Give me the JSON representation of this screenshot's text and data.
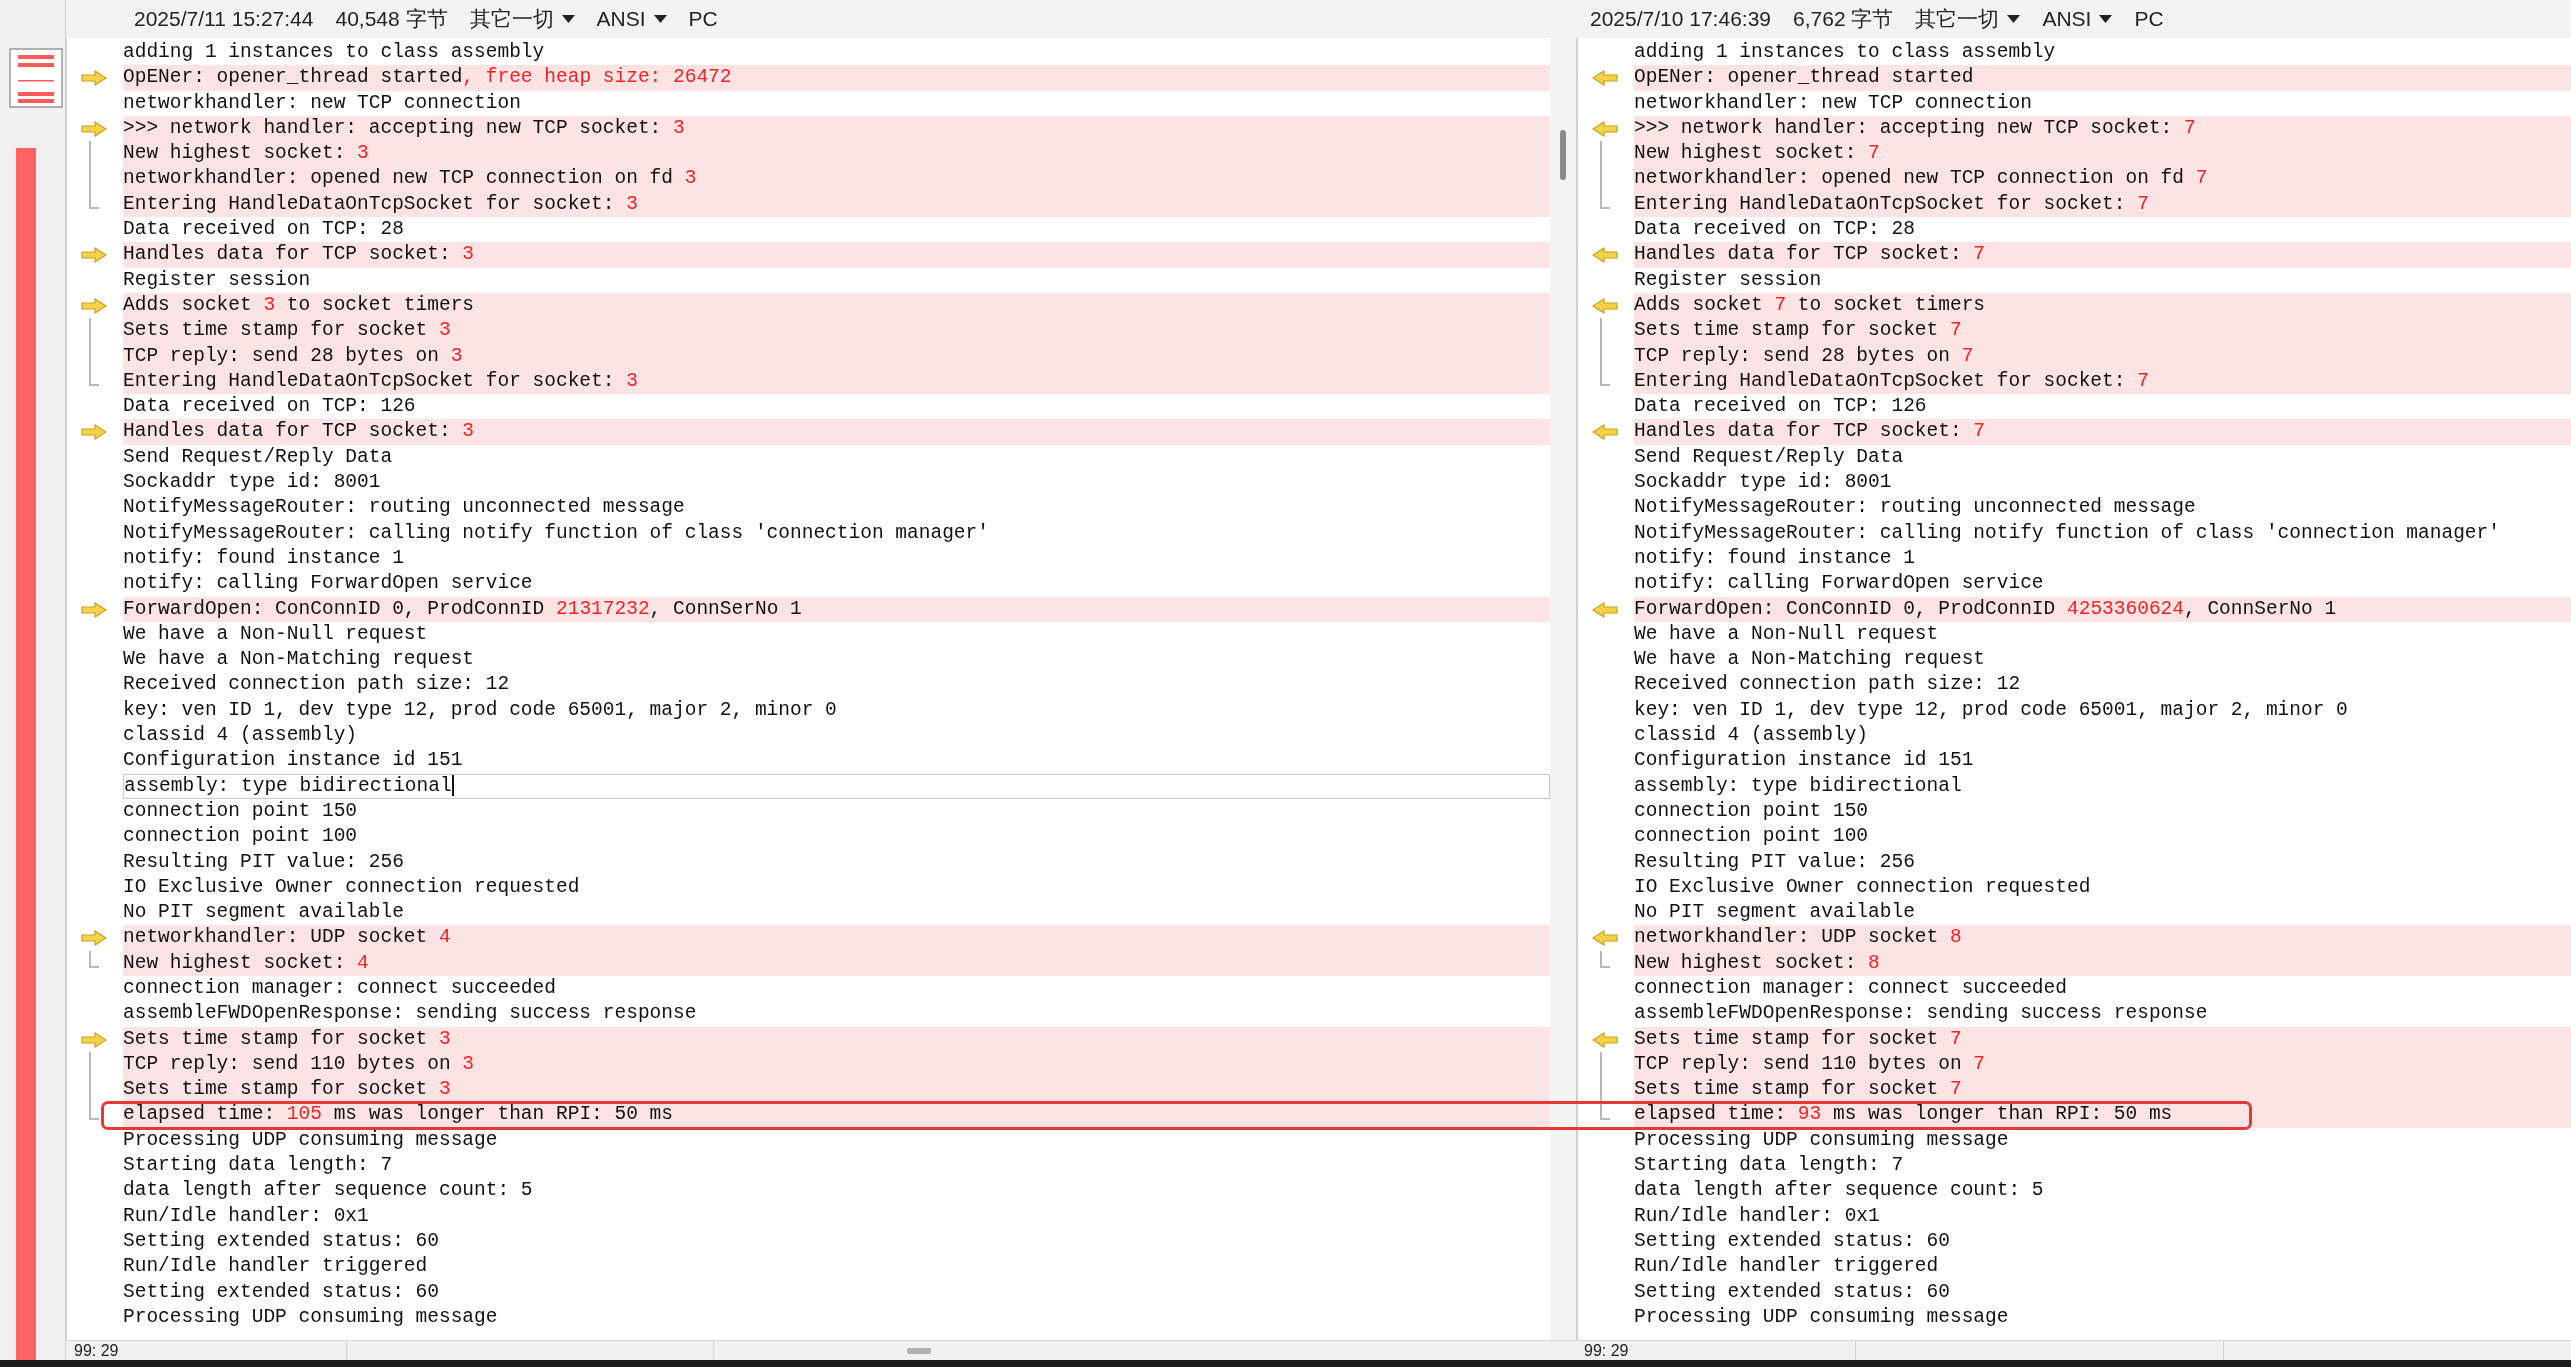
{
  "panes": [
    {
      "kind": "left",
      "header": {
        "timestamp": "2025/7/11 15:27:44",
        "size": "40,548 字节",
        "encoding": "其它一切",
        "charset": "ANSI",
        "line_endings": "PC"
      },
      "status_bar": {
        "position": "99: 29"
      },
      "lines": [
        {
          "text": "adding 1 instances to class assembly",
          "differs": false
        },
        {
          "text": "OpENer: opener_thread started",
          "changed": ", free heap size: 26472",
          "differs": true
        },
        {
          "text": "networkhandler: new TCP connection",
          "differs": false
        },
        {
          "text": ">>> network handler: accepting new TCP socket: ",
          "changed": "3",
          "differs": true
        },
        {
          "text": "New highest socket: ",
          "changed": "3",
          "differs": true
        },
        {
          "text": "networkhandler: opened new TCP connection on fd ",
          "changed": "3",
          "differs": true
        },
        {
          "text": "Entering HandleDataOnTcpSocket for socket: ",
          "changed": "3",
          "differs": true
        },
        {
          "text": "Data received on TCP: 28",
          "differs": false
        },
        {
          "text": "Handles data for TCP socket: ",
          "changed": "3",
          "differs": true
        },
        {
          "text": "Register session",
          "differs": false
        },
        {
          "text": "Adds socket ",
          "changed": "3",
          "after": " to socket timers",
          "differs": true
        },
        {
          "text": "Sets time stamp for socket ",
          "changed": "3",
          "differs": true
        },
        {
          "text": "TCP reply: send 28 bytes on ",
          "changed": "3",
          "differs": true
        },
        {
          "text": "Entering HandleDataOnTcpSocket for socket: ",
          "changed": "3",
          "differs": true
        },
        {
          "text": "Data received on TCP: 126",
          "differs": false
        },
        {
          "text": "Handles data for TCP socket: ",
          "changed": "3",
          "differs": true
        },
        {
          "text": "Send Request/Reply Data",
          "differs": false
        },
        {
          "text": "Sockaddr type id: 8001",
          "differs": false
        },
        {
          "text": "NotifyMessageRouter: routing unconnected message",
          "differs": false
        },
        {
          "text": "NotifyMessageRouter: calling notify function of class 'connection manager'",
          "differs": false
        },
        {
          "text": "notify: found instance 1",
          "differs": false
        },
        {
          "text": "notify: calling ForwardOpen service",
          "differs": false
        },
        {
          "text": "ForwardOpen: ConConnID 0, ProdConnID ",
          "changed": "21317232",
          "after": ", ConnSerNo 1",
          "differs": true
        },
        {
          "text": "We have a Non-Null request",
          "differs": false
        },
        {
          "text": "We have a Non-Matching request",
          "differs": false
        },
        {
          "text": "Received connection path size: 12",
          "differs": false
        },
        {
          "text": "key: ven ID 1, dev type 12, prod code 65001, major 2, minor 0",
          "differs": false
        },
        {
          "text": "classid 4 (assembly)",
          "differs": false
        },
        {
          "text": "Configuration instance id 151",
          "differs": false
        },
        {
          "text": "assembly: type bidirectional",
          "differs": false,
          "current": true
        },
        {
          "text": "connection point 150",
          "differs": false
        },
        {
          "text": "connection point 100",
          "differs": false
        },
        {
          "text": "Resulting PIT value: 256",
          "differs": false
        },
        {
          "text": "IO Exclusive Owner connection requested",
          "differs": false
        },
        {
          "text": "No PIT segment available",
          "differs": false
        },
        {
          "text": "networkhandler: UDP socket ",
          "changed": "4",
          "differs": true
        },
        {
          "text": "New highest socket: ",
          "changed": "4",
          "differs": true
        },
        {
          "text": "connection manager: connect succeeded",
          "differs": false
        },
        {
          "text": "assembleFWDOpenResponse: sending success response",
          "differs": false
        },
        {
          "text": "Sets time stamp for socket ",
          "changed": "3",
          "differs": true
        },
        {
          "text": "TCP reply: send 110 bytes on ",
          "changed": "3",
          "differs": true
        },
        {
          "text": "Sets time stamp for socket ",
          "changed": "3",
          "differs": true
        },
        {
          "text": "elapsed time: ",
          "changed": "105",
          "after": " ms was longer than RPI: 50 ms",
          "differs": true,
          "circled": true
        },
        {
          "text": "Processing UDP consuming message",
          "differs": false
        },
        {
          "text": "Starting data length: 7",
          "differs": false
        },
        {
          "text": "data length after sequence count: 5",
          "differs": false
        },
        {
          "text": "Run/Idle handler: 0x1",
          "differs": false
        },
        {
          "text": "Setting extended status: 60",
          "differs": false
        },
        {
          "text": "Run/Idle handler triggered",
          "differs": false
        },
        {
          "text": "Setting extended status: 60",
          "differs": false
        },
        {
          "text": "Processing UDP consuming message",
          "differs": false
        }
      ]
    },
    {
      "kind": "right",
      "header": {
        "timestamp": "2025/7/10 17:46:39",
        "size": "6,762 字节",
        "encoding": "其它一切",
        "charset": "ANSI",
        "line_endings": "PC"
      },
      "status_bar": {
        "position": "99: 29"
      },
      "lines": [
        {
          "text": "adding 1 instances to class assembly",
          "differs": false
        },
        {
          "text": "OpENer: opener_thread started",
          "differs": true
        },
        {
          "text": "networkhandler: new TCP connection",
          "differs": false
        },
        {
          "text": ">>> network handler: accepting new TCP socket: ",
          "changed": "7",
          "differs": true
        },
        {
          "text": "New highest socket: ",
          "changed": "7",
          "differs": true
        },
        {
          "text": "networkhandler: opened new TCP connection on fd ",
          "changed": "7",
          "differs": true
        },
        {
          "text": "Entering HandleDataOnTcpSocket for socket: ",
          "changed": "7",
          "differs": true
        },
        {
          "text": "Data received on TCP: 28",
          "differs": false
        },
        {
          "text": "Handles data for TCP socket: ",
          "changed": "7",
          "differs": true
        },
        {
          "text": "Register session",
          "differs": false
        },
        {
          "text": "Adds socket ",
          "changed": "7",
          "after": " to socket timers",
          "differs": true
        },
        {
          "text": "Sets time stamp for socket ",
          "changed": "7",
          "differs": true
        },
        {
          "text": "TCP reply: send 28 bytes on ",
          "changed": "7",
          "differs": true
        },
        {
          "text": "Entering HandleDataOnTcpSocket for socket: ",
          "changed": "7",
          "differs": true
        },
        {
          "text": "Data received on TCP: 126",
          "differs": false
        },
        {
          "text": "Handles data for TCP socket: ",
          "changed": "7",
          "differs": true
        },
        {
          "text": "Send Request/Reply Data",
          "differs": false
        },
        {
          "text": "Sockaddr type id: 8001",
          "differs": false
        },
        {
          "text": "NotifyMessageRouter: routing unconnected message",
          "differs": false
        },
        {
          "text": "NotifyMessageRouter: calling notify function of class 'connection manager'",
          "differs": false
        },
        {
          "text": "notify: found instance 1",
          "differs": false
        },
        {
          "text": "notify: calling ForwardOpen service",
          "differs": false
        },
        {
          "text": "ForwardOpen: ConConnID 0, ProdConnID ",
          "changed": "4253360624",
          "after": ", ConnSerNo 1",
          "differs": true
        },
        {
          "text": "We have a Non-Null request",
          "differs": false
        },
        {
          "text": "We have a Non-Matching request",
          "differs": false
        },
        {
          "text": "Received connection path size: 12",
          "differs": false
        },
        {
          "text": "key: ven ID 1, dev type 12, prod code 65001, major 2, minor 0",
          "differs": false
        },
        {
          "text": "classid 4 (assembly)",
          "differs": false
        },
        {
          "text": "Configuration instance id 151",
          "differs": false
        },
        {
          "text": "assembly: type bidirectional",
          "differs": false
        },
        {
          "text": "connection point 150",
          "differs": false
        },
        {
          "text": "connection point 100",
          "differs": false
        },
        {
          "text": "Resulting PIT value: 256",
          "differs": false
        },
        {
          "text": "IO Exclusive Owner connection requested",
          "differs": false
        },
        {
          "text": "No PIT segment available",
          "differs": false
        },
        {
          "text": "networkhandler: UDP socket ",
          "changed": "8",
          "differs": true
        },
        {
          "text": "New highest socket: ",
          "changed": "8",
          "differs": true
        },
        {
          "text": "connection manager: connect succeeded",
          "differs": false
        },
        {
          "text": "assembleFWDOpenResponse: sending success response",
          "differs": false
        },
        {
          "text": "Sets time stamp for socket ",
          "changed": "7",
          "differs": true
        },
        {
          "text": "TCP reply: send 110 bytes on ",
          "changed": "7",
          "differs": true
        },
        {
          "text": "Sets time stamp for socket ",
          "changed": "7",
          "differs": true
        },
        {
          "text": "elapsed time: ",
          "changed": "93",
          "after": " ms was longer than RPI: 50 ms",
          "differs": true,
          "circled": true
        },
        {
          "text": "Processing UDP consuming message",
          "differs": false
        },
        {
          "text": "Starting data length: 7",
          "differs": false
        },
        {
          "text": "data length after sequence count: 5",
          "differs": false
        },
        {
          "text": "Run/Idle handler: 0x1",
          "differs": false
        },
        {
          "text": "Setting extended status: 60",
          "differs": false
        },
        {
          "text": "Run/Idle handler triggered",
          "differs": false
        },
        {
          "text": "Setting extended status: 60",
          "differs": false
        },
        {
          "text": "Processing UDP consuming message",
          "differs": false
        }
      ]
    }
  ]
}
